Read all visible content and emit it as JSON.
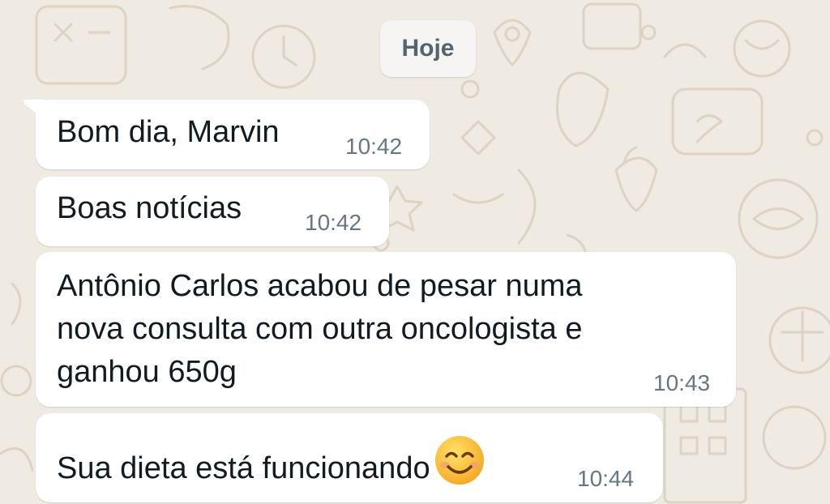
{
  "chat": {
    "date_divider": "Hoje",
    "messages": [
      {
        "text": "Bom dia, Marvin",
        "time": "10:42"
      },
      {
        "text": "Boas notícias",
        "time": "10:42"
      },
      {
        "lines": [
          "Antônio Carlos acabou de pesar numa",
          "nova consulta com outra oncologista  e",
          "ganhou 650g"
        ],
        "time": "10:43"
      },
      {
        "text": "Sua dieta está funcionando",
        "emoji": "smiling-face-icon",
        "time": "10:44"
      }
    ]
  },
  "colors": {
    "background": "#efeae2",
    "bubble": "#ffffff",
    "text": "#111b21",
    "timestamp": "#667781",
    "divider_text": "#54656f"
  }
}
